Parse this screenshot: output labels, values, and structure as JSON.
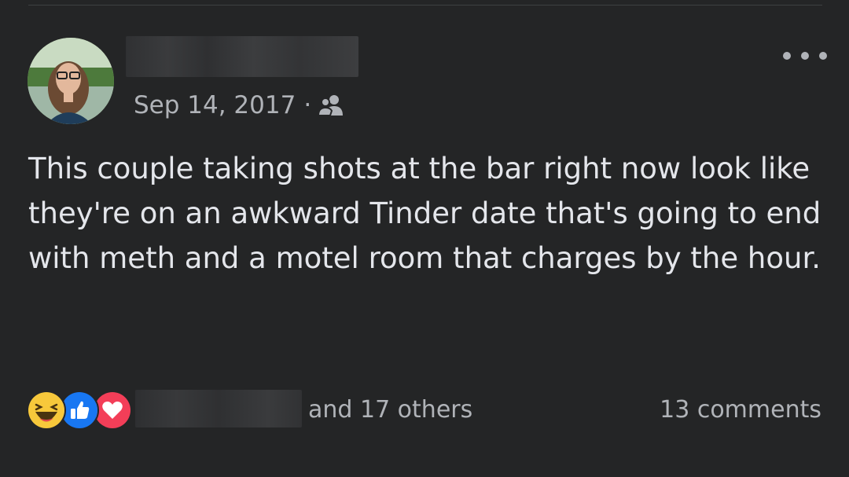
{
  "post": {
    "date": "Sep 14, 2017",
    "separator": "·",
    "audience_icon": "friends-icon",
    "body": "This couple taking shots at the bar right now look like they're on an awkward Tinder date that's going to end with meth and a motel room that charges by the hour."
  },
  "reactions": {
    "icons": [
      "haha-reaction-icon",
      "like-reaction-icon",
      "love-reaction-icon"
    ],
    "others_label": "and 17 others",
    "comments_label": "13 comments"
  },
  "colors": {
    "background": "#242526",
    "text_primary": "#e4e6eb",
    "text_secondary": "#b0b3b8",
    "like_blue": "#1877f2",
    "love_red": "#f33e58",
    "haha_yellow": "#f7c83b"
  }
}
